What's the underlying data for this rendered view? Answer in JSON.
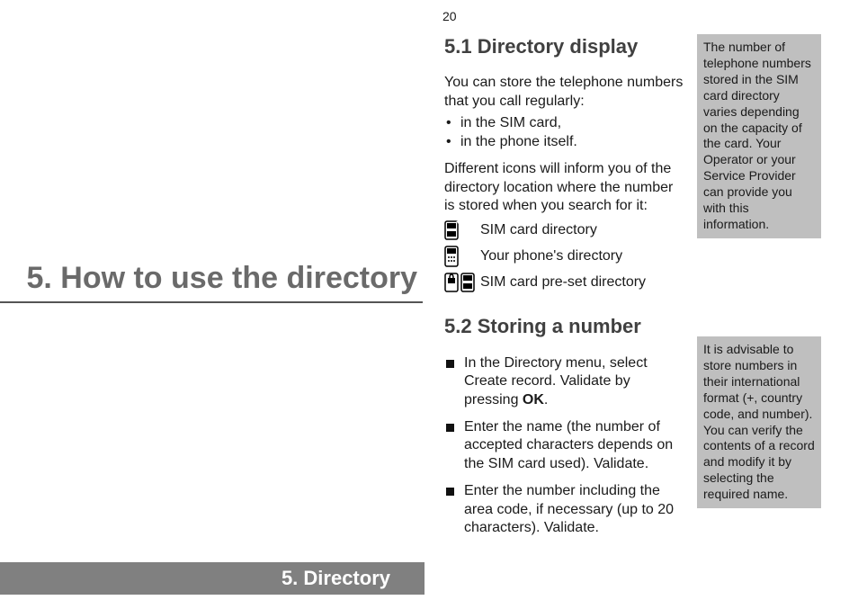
{
  "pageNumber": "20",
  "chapterTitle": "5.  How to use the directory",
  "footer": "5. Directory",
  "section1": {
    "heading": "5.1  Directory display",
    "intro": "You can store the telephone numbers that you call regularly:",
    "bullets": [
      "in the SIM card,",
      "in the phone itself."
    ],
    "iconsIntro": "Different icons will inform you of the directory location where the number is stored when you search for it:",
    "icons": {
      "sim": "SIM card directory",
      "phone": "Your phone's directory",
      "preset": "SIM card pre-set directory"
    }
  },
  "section2": {
    "heading": "5.2  Storing a number",
    "steps": [
      {
        "pre": "In the Directory menu, select Create record. Validate by pressing ",
        "bold": "OK",
        "post": "."
      },
      {
        "pre": "Enter the name (the number of accepted characters depends on the SIM card used). Validate.",
        "bold": "",
        "post": ""
      },
      {
        "pre": "Enter the number including the area code, if necessary (up to 20 characters). Validate.",
        "bold": "",
        "post": ""
      }
    ]
  },
  "sideNotes": {
    "note1": "The number of telephone numbers stored in the SIM card directory varies depending on the capacity of the card. Your Operator or your Service Provider can provide you with this information.",
    "note2": "It is advisable to store numbers in their international format (+, country code, and number). You can verify the contents of a record and modify it by selecting the required name."
  }
}
